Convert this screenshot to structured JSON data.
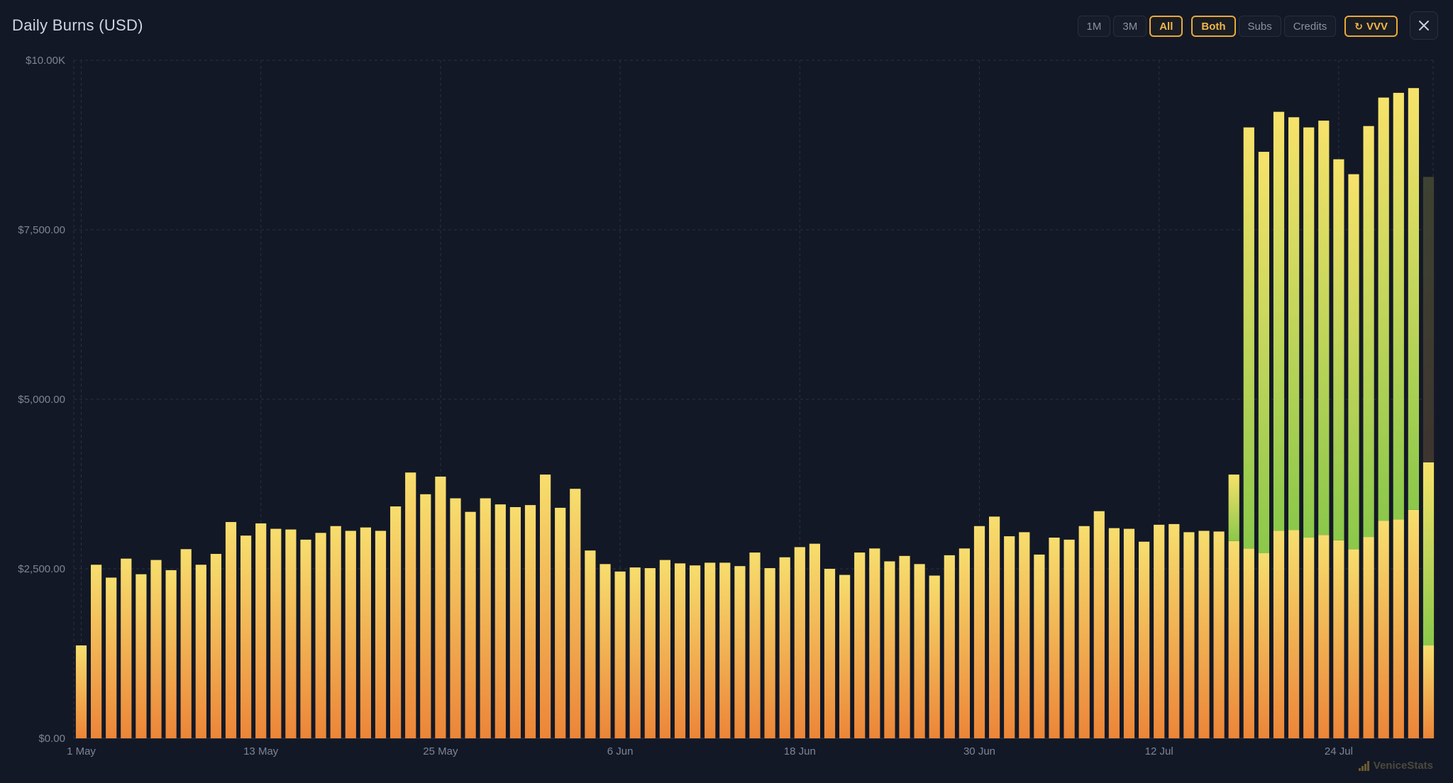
{
  "title": "Daily Burns (USD)",
  "controls": {
    "range_buttons": [
      "1M",
      "3M",
      "All"
    ],
    "active_range": "All",
    "type_buttons": [
      "Both",
      "Subs",
      "Credits"
    ],
    "active_type": "Both",
    "token_button": "VVV"
  },
  "brand": "VeniceStats",
  "colors": {
    "background": "#131826",
    "accent": "#e9a93a",
    "bar_bottom": "#ec8538",
    "bar_top": "#f7de6e",
    "subs_bottom": "#8bc84a",
    "subs_top": "#f7e26a",
    "grid": "#2a3142"
  },
  "chart_data": {
    "type": "bar",
    "stacked": true,
    "title": "Daily Burns (USD)",
    "ylim": [
      0,
      10000
    ],
    "y_ticks": [
      0,
      2500,
      5000,
      7500,
      10000
    ],
    "y_tick_labels": [
      "$0.00",
      "$2,500.00",
      "$5,000.00",
      "$7,500.00",
      "$10.00K"
    ],
    "x_tick_labels": [
      "1 May",
      "13 May",
      "25 May",
      "6 Jun",
      "18 Jun",
      "30 Jun",
      "12 Jul",
      "24 Jul"
    ],
    "x_tick_index": [
      0,
      12,
      24,
      36,
      48,
      60,
      72,
      84
    ],
    "grid": true,
    "series": [
      {
        "values": [
          1370,
          2560,
          2370,
          2650,
          2420,
          2630,
          2480,
          2790,
          2560,
          2720,
          3190,
          2990,
          3170,
          3090,
          3080,
          2930,
          3030,
          3130,
          3060,
          3110,
          3060,
          3420,
          3920,
          3600,
          3860,
          3540,
          3340,
          3540,
          3450,
          3410,
          3440,
          3890,
          3400,
          3680,
          2770,
          2570,
          2460,
          2520,
          2510,
          2630,
          2580,
          2550,
          2590,
          2590,
          2540,
          2740,
          2510,
          2670,
          2820,
          2870,
          2500,
          2410,
          2740,
          2800,
          2610,
          2690,
          2570,
          2400,
          2700,
          2800,
          3130,
          3270,
          2980,
          3040,
          2710,
          2960,
          2930,
          3130,
          3350,
          3100,
          3090,
          2900,
          3150,
          3160,
          3040,
          3060,
          3050,
          2910,
          2800,
          2730,
          3060,
          3070,
          2960,
          3000,
          2920,
          2790,
          2970,
          3210,
          3230,
          3370,
          1370
        ]
      },
      {
        "values": [
          0,
          0,
          0,
          0,
          0,
          0,
          0,
          0,
          0,
          0,
          0,
          0,
          0,
          0,
          0,
          0,
          0,
          0,
          0,
          0,
          0,
          0,
          0,
          0,
          0,
          0,
          0,
          0,
          0,
          0,
          0,
          0,
          0,
          0,
          0,
          0,
          0,
          0,
          0,
          0,
          0,
          0,
          0,
          0,
          0,
          0,
          0,
          0,
          0,
          0,
          0,
          0,
          0,
          0,
          0,
          0,
          0,
          0,
          0,
          0,
          0,
          0,
          0,
          0,
          0,
          0,
          0,
          0,
          0,
          0,
          0,
          0,
          0,
          0,
          0,
          0,
          0,
          980,
          6210,
          5920,
          6180,
          6090,
          6050,
          6110,
          5620,
          5530,
          6060,
          6240,
          6290,
          6220,
          2700
        ]
      },
      {
        "values": [
          0,
          0,
          0,
          0,
          0,
          0,
          0,
          0,
          0,
          0,
          0,
          0,
          0,
          0,
          0,
          0,
          0,
          0,
          0,
          0,
          0,
          0,
          0,
          0,
          0,
          0,
          0,
          0,
          0,
          0,
          0,
          0,
          0,
          0,
          0,
          0,
          0,
          0,
          0,
          0,
          0,
          0,
          0,
          0,
          0,
          0,
          0,
          0,
          0,
          0,
          0,
          0,
          0,
          0,
          0,
          0,
          0,
          0,
          0,
          0,
          0,
          0,
          0,
          0,
          0,
          0,
          0,
          0,
          0,
          0,
          0,
          0,
          0,
          0,
          0,
          0,
          0,
          0,
          0,
          0,
          0,
          0,
          0,
          0,
          0,
          0,
          0,
          0,
          0,
          0,
          4210
        ]
      }
    ]
  }
}
